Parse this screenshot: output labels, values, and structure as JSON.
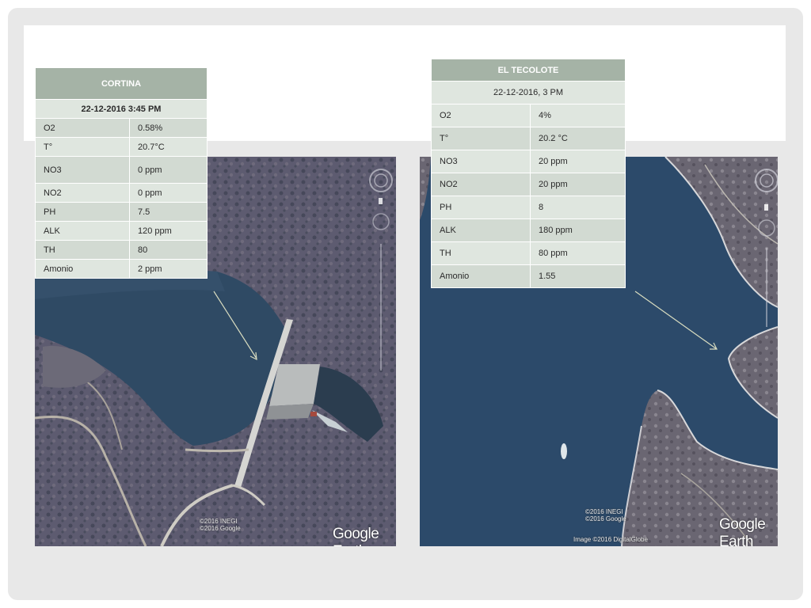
{
  "cortina": {
    "title": "CORTINA",
    "date": "22-12-2016  3:45 PM",
    "rows": [
      {
        "param": "O2",
        "value": "0.58%"
      },
      {
        "param": "T°",
        "value": "20.7°C"
      },
      {
        "param": "NO3",
        "value": "0 ppm"
      },
      {
        "param": "NO2",
        "value": "0 ppm"
      },
      {
        "param": "PH",
        "value": "7.5"
      },
      {
        "param": "ALK",
        "value": "120 ppm"
      },
      {
        "param": "TH",
        "value": "80"
      },
      {
        "param": "Amonio",
        "value": "2 ppm"
      }
    ]
  },
  "tecolote": {
    "title": "EL TECOLOTE",
    "date": "22-12-2016,  3 PM",
    "rows": [
      {
        "param": "O2",
        "value": "4%"
      },
      {
        "param": "T°",
        "value": "20.2 °C"
      },
      {
        "param": "NO3",
        "value": "20 ppm"
      },
      {
        "param": "NO2",
        "value": "20 ppm"
      },
      {
        "param": "PH",
        "value": "8"
      },
      {
        "param": "ALK",
        "value": "180 ppm"
      },
      {
        "param": "TH",
        "value": "80 ppm"
      },
      {
        "param": "Amonio",
        "value": "1.55"
      }
    ]
  },
  "map_left": {
    "credits_line1": "©2016 INEGI",
    "credits_line2": "©2016 Google",
    "watermark": "Google Earth"
  },
  "map_right": {
    "credits_line1": "©2016 INEGI",
    "credits_line2": "©2016 Google",
    "image_credit": "Image ©2016 DigitalGlobe",
    "watermark": "Google Earth"
  },
  "colors": {
    "table_header": "#a5b3a6",
    "table_row": "#d2dad2",
    "table_row_alt": "#dfe6df",
    "water": "#2e4a66",
    "terrain": "#5b5a6e"
  }
}
